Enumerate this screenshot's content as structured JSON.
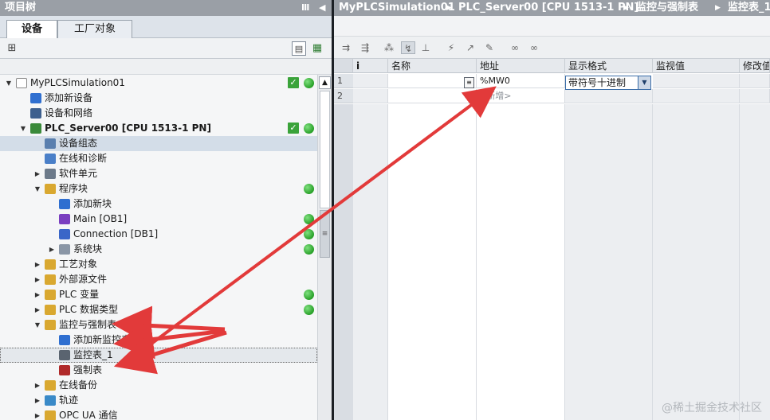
{
  "left_panel": {
    "title": "项目树",
    "title_controls": [
      "Ⅲ",
      "◀"
    ],
    "tabs": [
      {
        "label": "设备",
        "active": true
      },
      {
        "label": "工厂对象",
        "active": false
      }
    ],
    "tree": [
      {
        "id": "project",
        "label": "MyPLCSimulation01",
        "depth": 0,
        "expander": "▼",
        "icon": "project-icon",
        "icon_color": "#ffffff",
        "status_check": true,
        "status_dot": true
      },
      {
        "id": "add-device",
        "label": "添加新设备",
        "depth": 1,
        "expander": "",
        "icon": "add-device-icon",
        "icon_color": "#2f6fd0"
      },
      {
        "id": "devices-networks",
        "label": "设备和网络",
        "depth": 1,
        "expander": "",
        "icon": "network-icon",
        "icon_color": "#3d5f8e"
      },
      {
        "id": "plc-server",
        "label": "PLC_Server00 [CPU 1513-1 PN]",
        "depth": 1,
        "expander": "▼",
        "icon": "plc-icon",
        "icon_color": "#3a8a3a",
        "status_check": true,
        "status_dot": true,
        "bold": true
      },
      {
        "id": "device-config",
        "label": "设备组态",
        "depth": 2,
        "expander": "",
        "icon": "device-config-icon",
        "icon_color": "#5a7fae",
        "highlight": "a"
      },
      {
        "id": "online-diag",
        "label": "在线和诊断",
        "depth": 2,
        "expander": "",
        "icon": "diagnostics-icon",
        "icon_color": "#4a7fc8"
      },
      {
        "id": "software-units",
        "label": "软件单元",
        "depth": 2,
        "expander": "▶",
        "icon": "software-unit-icon",
        "icon_color": "#6c7a8a"
      },
      {
        "id": "program-blocks",
        "label": "程序块",
        "depth": 2,
        "expander": "▼",
        "icon": "folder-icon",
        "icon_color": "#d9a830",
        "status_dot": true
      },
      {
        "id": "add-block",
        "label": "添加新块",
        "depth": 3,
        "expander": "",
        "icon": "add-block-icon",
        "icon_color": "#2f6fd0"
      },
      {
        "id": "main-ob1",
        "label": "Main [OB1]",
        "depth": 3,
        "expander": "",
        "icon": "ob-block-icon",
        "icon_color": "#7a3fc0",
        "status_dot": true
      },
      {
        "id": "connection-db1",
        "label": "Connection [DB1]",
        "depth": 3,
        "expander": "",
        "icon": "db-block-icon",
        "icon_color": "#3a66c8",
        "status_dot": true
      },
      {
        "id": "system-blocks",
        "label": "系统块",
        "depth": 3,
        "expander": "▶",
        "icon": "system-block-icon",
        "icon_color": "#8a96a6",
        "status_dot": true
      },
      {
        "id": "tech-objects",
        "label": "工艺对象",
        "depth": 2,
        "expander": "▶",
        "icon": "folder-icon",
        "icon_color": "#d9a830"
      },
      {
        "id": "external-sources",
        "label": "外部源文件",
        "depth": 2,
        "expander": "▶",
        "icon": "folder-icon",
        "icon_color": "#d9a830"
      },
      {
        "id": "plc-tags",
        "label": "PLC 变量",
        "depth": 2,
        "expander": "▶",
        "icon": "folder-icon",
        "icon_color": "#d9a830",
        "status_dot": true
      },
      {
        "id": "plc-datatypes",
        "label": "PLC 数据类型",
        "depth": 2,
        "expander": "▶",
        "icon": "folder-icon",
        "icon_color": "#d9a830",
        "status_dot": true
      },
      {
        "id": "watch-force-tables",
        "label": "监控与强制表",
        "depth": 2,
        "expander": "▼",
        "icon": "folder-icon",
        "icon_color": "#d9a830"
      },
      {
        "id": "add-watch-table",
        "label": "添加新监控表",
        "depth": 3,
        "expander": "",
        "icon": "add-watch-table-icon",
        "icon_color": "#2f6fd0"
      },
      {
        "id": "watch-table-1",
        "label": "监控表_1",
        "depth": 3,
        "expander": "",
        "icon": "watch-table-icon",
        "icon_color": "#5a6470",
        "highlight": "b"
      },
      {
        "id": "force-table",
        "label": "强制表",
        "depth": 3,
        "expander": "",
        "icon": "force-table-icon",
        "icon_color": "#b02a2a"
      },
      {
        "id": "online-backup",
        "label": "在线备份",
        "depth": 2,
        "expander": "▶",
        "icon": "folder-icon",
        "icon_color": "#d9a830"
      },
      {
        "id": "traces",
        "label": "轨迹",
        "depth": 2,
        "expander": "▶",
        "icon": "trace-icon",
        "icon_color": "#3a8ac8"
      },
      {
        "id": "opc-ua",
        "label": "OPC UA 通信",
        "depth": 2,
        "expander": "▶",
        "icon": "folder-icon",
        "icon_color": "#d9a830"
      }
    ]
  },
  "breadcrumb": [
    "MyPLCSimulation01",
    "PLC_Server00 [CPU 1513-1 PN]",
    "监控与强制表",
    "监控表_1"
  ],
  "watch_table": {
    "columns": [
      "",
      "i",
      "名称",
      "地址",
      "显示格式",
      "监视值",
      "修改值"
    ],
    "rows": [
      {
        "num": "1",
        "name": "",
        "address": "%MW0",
        "format": "带符号十进制"
      },
      {
        "num": "2",
        "name": "",
        "address": "<新增>",
        "format": ""
      }
    ]
  },
  "watermark": "@稀土掘金技术社区",
  "colors": {
    "title_bar": "#9a9fa6",
    "status_green": "#28a028",
    "arrow_red": "#e23a3a"
  }
}
